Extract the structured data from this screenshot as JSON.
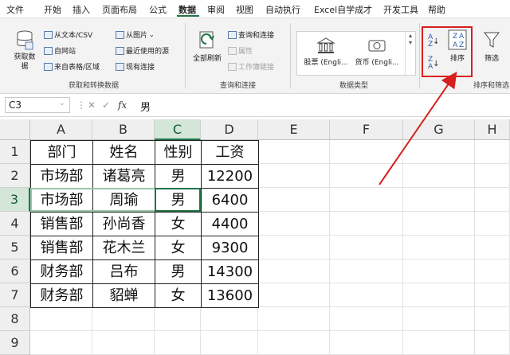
{
  "tabs": [
    "文件",
    "开始",
    "插入",
    "页面布局",
    "公式",
    "数据",
    "审阅",
    "视图",
    "自动执行",
    "Excel自学成才",
    "开发工具",
    "帮助"
  ],
  "ribbon": {
    "get_data": "获取数据",
    "from_text_csv": "从文本/CSV",
    "from_web": "自网站",
    "from_table": "来自表格/区域",
    "from_picture": "从图片",
    "recent_sources": "最近使用的源",
    "existing_conn": "现有连接",
    "group1_label": "获取和转换数据",
    "refresh_all": "全部刷新",
    "queries_conn": "查询和连接",
    "properties": "属性",
    "edit_links": "工作簿链接",
    "group2_label": "查询和连接",
    "stocks": "股票 (Engli...",
    "currency": "货币 (Engli...",
    "group3_label": "数据类型",
    "sort": "排序",
    "filter": "筛选",
    "group4_label": "排序和筛选"
  },
  "formula_bar": {
    "name_box": "C3",
    "content": "男"
  },
  "columns": [
    "A",
    "B",
    "C",
    "D",
    "E",
    "F",
    "G",
    "H"
  ],
  "rows": [
    "1",
    "2",
    "3",
    "4",
    "5",
    "6",
    "7",
    "8",
    "9"
  ],
  "table": [
    [
      "部门",
      "姓名",
      "性别",
      "工资"
    ],
    [
      "市场部",
      "诸葛亮",
      "男",
      "12200"
    ],
    [
      "市场部",
      "周瑜",
      "男",
      "6400"
    ],
    [
      "销售部",
      "孙尚香",
      "女",
      "4400"
    ],
    [
      "销售部",
      "花木兰",
      "女",
      "9300"
    ],
    [
      "财务部",
      "吕布",
      "男",
      "14300"
    ],
    [
      "财务部",
      "貂蝉",
      "女",
      "13600"
    ]
  ],
  "colors": {
    "accent": "#217346",
    "highlight": "#d81f1f"
  }
}
